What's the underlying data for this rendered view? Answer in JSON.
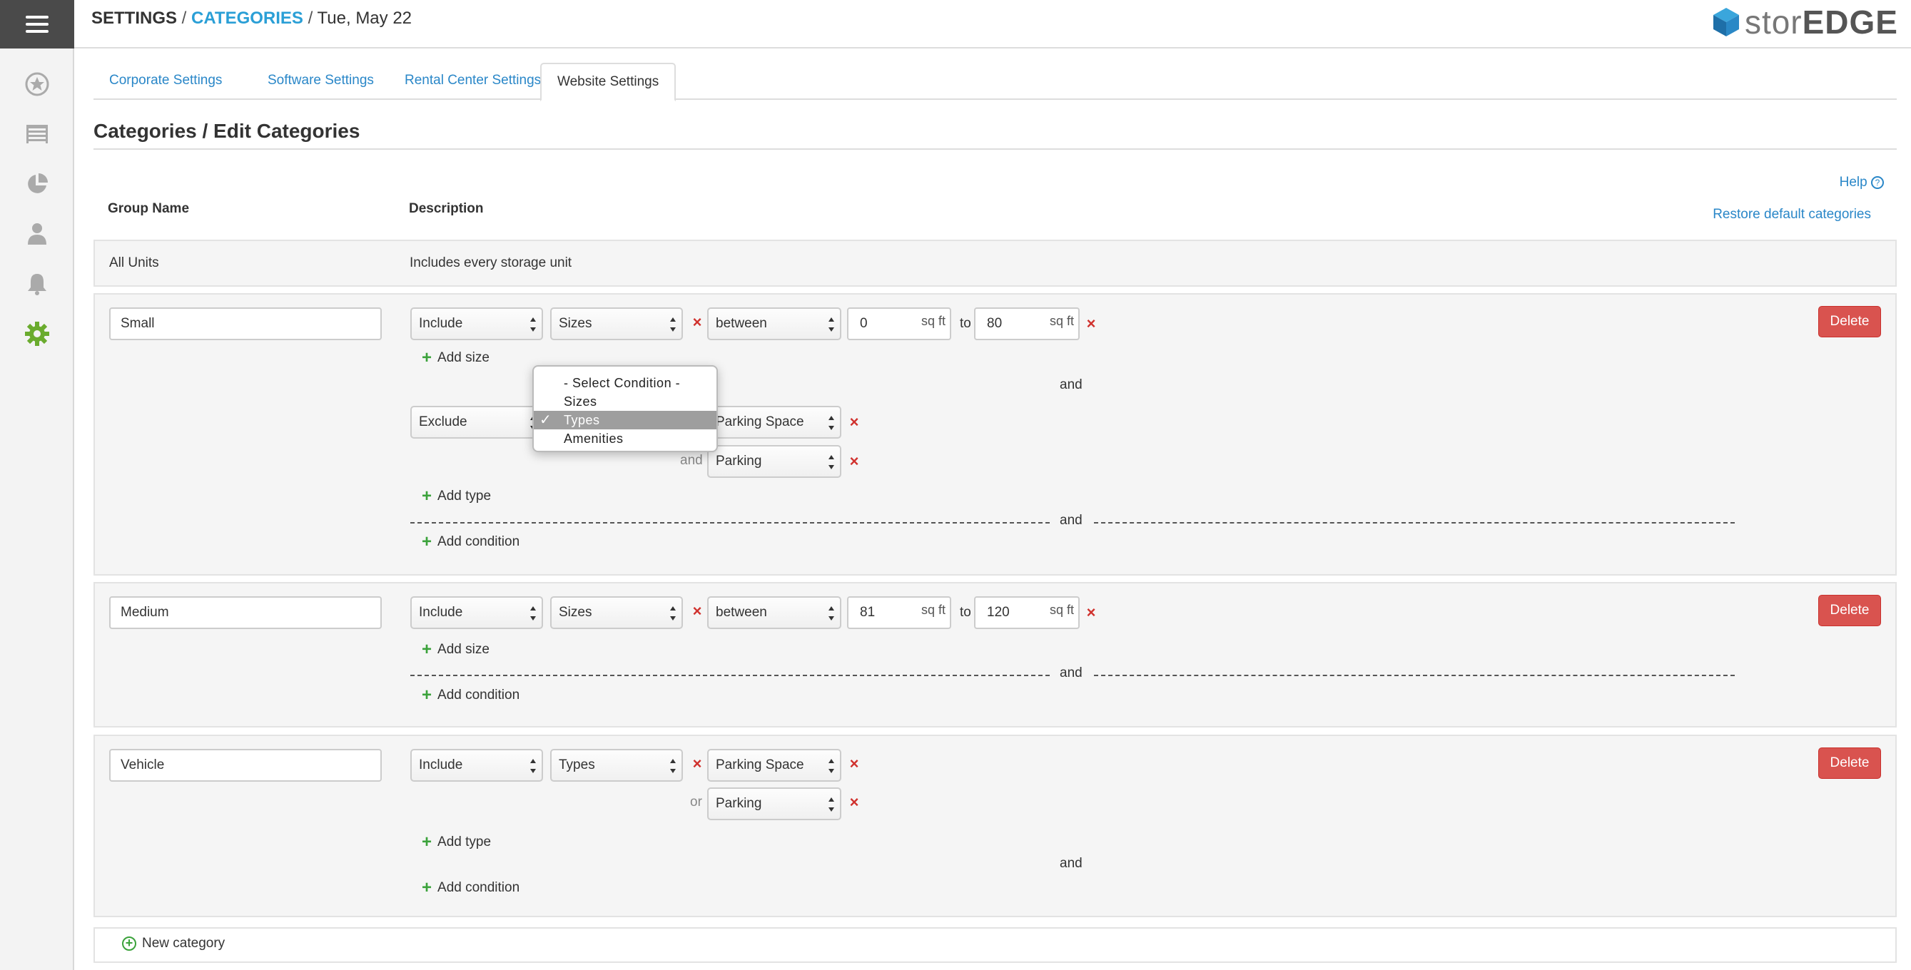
{
  "header": {
    "breadcrumb_settings": "SETTINGS",
    "breadcrumb_sep1": " / ",
    "breadcrumb_categories": "CATEGORIES",
    "breadcrumb_sep2": " / ",
    "breadcrumb_date": "Tue, May 22",
    "logo_light": "stor",
    "logo_bold": "EDGE"
  },
  "sidebar": {
    "items": [
      {
        "icon": "star-icon"
      },
      {
        "icon": "storage-units-icon"
      },
      {
        "icon": "reports-pie-icon"
      },
      {
        "icon": "user-icon"
      },
      {
        "icon": "bell-icon"
      },
      {
        "icon": "gear-icon",
        "active": true
      }
    ],
    "active_color": "#6aab2e"
  },
  "tabs": [
    {
      "label": "Corporate Settings"
    },
    {
      "label": "Software Settings"
    },
    {
      "label": "Rental Center Settings"
    },
    {
      "label": "Website Settings",
      "active": true
    }
  ],
  "page": {
    "title": "Categories / Edit Categories",
    "help": "Help",
    "restore": "Restore default categories",
    "col_group": "Group Name",
    "col_description": "Description"
  },
  "all_units": {
    "name": "All Units",
    "description": "Includes every storage unit"
  },
  "categories": [
    {
      "name": "Small",
      "rule1": {
        "mode": "Include",
        "condition": "Sizes",
        "operator": "between",
        "from": "0",
        "to": "80",
        "unit": "sq ft",
        "to_label": "to"
      },
      "add_size": "Add size",
      "and1": "and",
      "rule2": {
        "mode": "Exclude",
        "type1": "Parking Space",
        "joiner": "and",
        "type2": "Parking"
      },
      "add_type": "Add type",
      "and2": "and",
      "add_condition": "Add condition",
      "delete": "Delete"
    },
    {
      "name": "Medium",
      "rule1": {
        "mode": "Include",
        "condition": "Sizes",
        "operator": "between",
        "from": "81",
        "to": "120",
        "unit": "sq ft",
        "to_label": "to"
      },
      "add_size": "Add size",
      "and1": "and",
      "add_condition": "Add condition",
      "delete": "Delete"
    },
    {
      "name": "Vehicle",
      "rule1": {
        "mode": "Include",
        "condition": "Types",
        "type1": "Parking Space",
        "joiner": "or",
        "type2": "Parking"
      },
      "add_type": "Add type",
      "and1": "and",
      "add_condition": "Add condition",
      "delete": "Delete"
    }
  ],
  "dropdown": {
    "options": [
      "- Select Condition -",
      "Sizes",
      "Types",
      "Amenities"
    ],
    "selected": "Types",
    "check": "✓"
  },
  "new_category": "New category",
  "colors": {
    "link": "#2a87c8",
    "accent": "#2a9fd6",
    "delete": "#d9534f",
    "remove": "#d0312d",
    "add": "#3ba23b"
  }
}
